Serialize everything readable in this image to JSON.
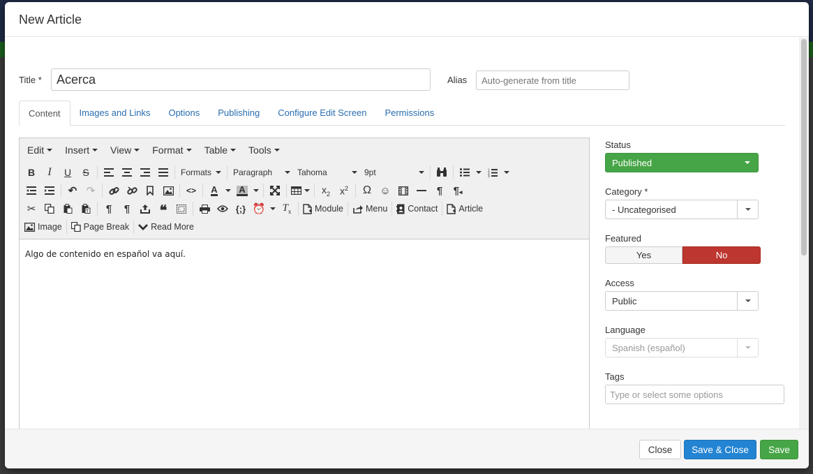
{
  "modal": {
    "title": "New Article"
  },
  "form": {
    "title_label": "Title *",
    "title_value": "Acerca",
    "alias_label": "Alias",
    "alias_placeholder": "Auto-generate from title"
  },
  "tabs": [
    {
      "label": "Content",
      "active": true
    },
    {
      "label": "Images and Links"
    },
    {
      "label": "Options"
    },
    {
      "label": "Publishing"
    },
    {
      "label": "Configure Edit Screen"
    },
    {
      "label": "Permissions"
    }
  ],
  "editor": {
    "menu": [
      "Edit",
      "Insert",
      "View",
      "Format",
      "Table",
      "Tools"
    ],
    "dropdowns": {
      "formats": "Formats",
      "block": "Paragraph",
      "font": "Tahoma",
      "size": "9pt"
    },
    "buttons": {
      "module": "Module",
      "menu": "Menu",
      "contact": "Contact",
      "article": "Article",
      "image": "Image",
      "page_break": "Page Break",
      "read_more": "Read More"
    },
    "content": "Algo de contenido en español va aquí."
  },
  "sidebar": {
    "status": {
      "label": "Status",
      "value": "Published"
    },
    "category": {
      "label": "Category *",
      "value": "- Uncategorised"
    },
    "featured": {
      "label": "Featured",
      "yes": "Yes",
      "no": "No"
    },
    "access": {
      "label": "Access",
      "value": "Public"
    },
    "language": {
      "label": "Language",
      "value": "Spanish (español)"
    },
    "tags": {
      "label": "Tags",
      "placeholder": "Type or select some options"
    }
  },
  "footer": {
    "close": "Close",
    "save_close": "Save & Close",
    "save": "Save"
  },
  "colors": {
    "success": "#46a546",
    "danger": "#bd362f",
    "primary": "#2384d3",
    "link": "#2a6db0"
  }
}
